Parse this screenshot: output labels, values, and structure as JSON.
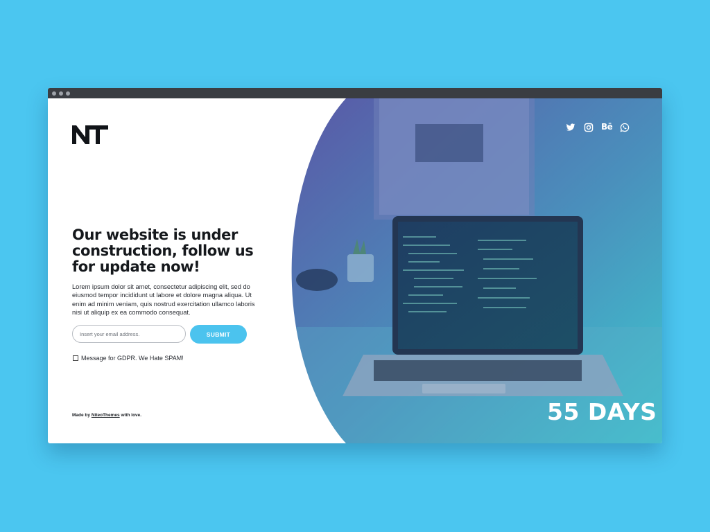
{
  "brand": {
    "logo_text": "NT"
  },
  "hero": {
    "headline": "Our website is under construction, follow us for update now!",
    "paragraph": "Lorem ipsum dolor sit amet, consectetur adipiscing elit, sed do eiusmod tempor incididunt ut labore et dolore magna aliqua. Ut enim ad minim veniam, quis nostrud exercitation ullamco laboris nisi ut aliquip ex ea commodo consequat."
  },
  "form": {
    "email_placeholder": "Insert your email address.",
    "submit_label": "SUBMIT",
    "gdpr_label": "Message for GDPR. We Hate SPAM!"
  },
  "footer": {
    "prefix": "Made by",
    "link_text": "NiteoThemes",
    "suffix": "with love."
  },
  "social": {
    "icons": [
      "twitter-icon",
      "instagram-icon",
      "behance-icon",
      "whatsapp-icon"
    ],
    "behance_text": "Bē"
  },
  "countdown": {
    "text": "55 DAYS"
  },
  "colors": {
    "background": "#4bc6f0",
    "accent": "#4bc3ee",
    "hero_gradient_start": "#5b5aa8",
    "hero_gradient_end": "#3fc3cf"
  }
}
